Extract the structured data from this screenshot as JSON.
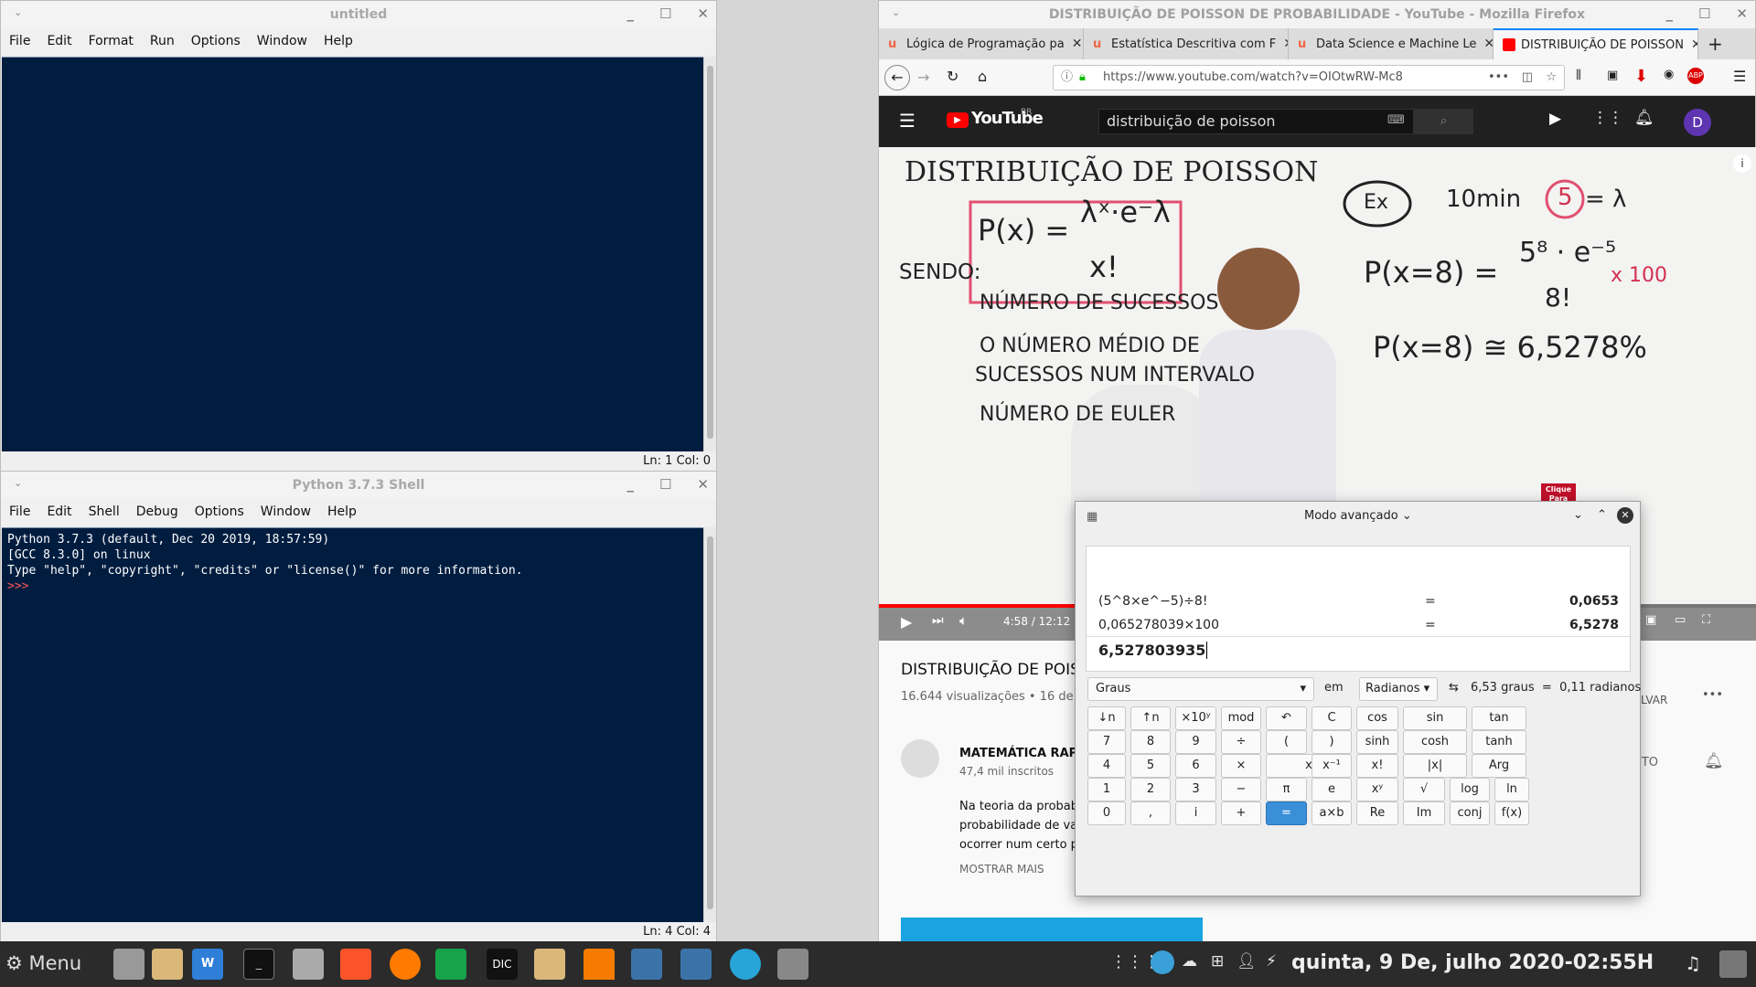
{
  "idle_editor": {
    "title": "untitled",
    "menu": [
      "File",
      "Edit",
      "Format",
      "Run",
      "Options",
      "Window",
      "Help"
    ],
    "status": "Ln: 1   Col: 0"
  },
  "idle_shell": {
    "title": "Python 3.7.3 Shell",
    "menu": [
      "File",
      "Edit",
      "Shell",
      "Debug",
      "Options",
      "Window",
      "Help"
    ],
    "lines": [
      "Python 3.7.3 (default, Dec 20 2019, 18:57:59)",
      "[GCC 8.3.0] on linux",
      "Type \"help\", \"copyright\", \"credits\" or \"license()\" for more information."
    ],
    "prompt": ">>>",
    "status": "Ln: 4   Col: 4"
  },
  "firefox": {
    "title": "DISTRIBUIÇÃO DE POISSON DE PROBABILIDADE - YouTube - Mozilla Firefox",
    "tabs": [
      {
        "label": "Lógica de Programação pa"
      },
      {
        "label": "Estatística Descritiva com F"
      },
      {
        "label": "Data Science e Machine Le"
      },
      {
        "label": "DISTRIBUIÇÃO DE POISSON"
      }
    ],
    "url": "https://www.youtube.com/watch?v=OIOtwRW-Mc8"
  },
  "youtube": {
    "logo": "YouTube",
    "region": "BR",
    "search": "distribuição de poisson",
    "avatar": "D",
    "video_time": "4:58 / 12:12",
    "video_title": "DISTRIBUIÇÃO DE POISS",
    "views": "16.644 visualizações • 16 de m",
    "channel": "MATEMÁTICA RAPID",
    "subs": "47,4 mil inscritos",
    "desc": [
      "Na teoria da probabi",
      "probabilidade de var",
      "ocorrer num certo pe"
    ],
    "more": "MOSTRAR MAIS",
    "save": "LVAR",
    "subscribe": "ITO",
    "badge": "Clique Para Assinar"
  },
  "whiteboard": {
    "heading": "DISTRIBUIÇÃO DE POISSON",
    "formula_num": "λˣ·e⁻λ",
    "formula_lhs": "P(x) =",
    "formula_den": "x!",
    "sendo": "SENDO:",
    "x_desc": "NÚMERO DE SUCESSOS",
    "lambda_desc1": "O NÚMERO MÉDIO DE",
    "lambda_desc2": "SUCESSOS NUM INTERVALO",
    "e_desc": "NÚMERO DE EULER",
    "ex": "Ex",
    "ex_line": "10min",
    "ex_val": "5",
    "ex_lam": "= λ",
    "calc_lhs": "P(x=8) =",
    "calc_num": "5⁸ · e⁻⁵",
    "calc_den": "8!",
    "calc_mult": "x 100",
    "result": "P(x=8) ≅ 6,5278%"
  },
  "calculator": {
    "mode": "Modo avançado",
    "history": [
      {
        "expr": "(5^8×e^−5)÷8!",
        "eq": "=",
        "val": "0,0653"
      },
      {
        "expr": "0,065278039×100",
        "eq": "=",
        "val": "6,5278"
      }
    ],
    "input": "6,527803935",
    "from_unit": "Graus",
    "in_label": "em",
    "to_unit": "Radianos",
    "conversion": "6,53 graus  =  0,11 radianos",
    "rows": [
      [
        "↓n",
        "↑n",
        "×10ʸ",
        "mod",
        "↶",
        "C",
        "cos",
        "sin",
        "tan"
      ],
      [
        "7",
        "8",
        "9",
        "÷",
        "(",
        ")",
        "sinh",
        "cosh",
        "tanh"
      ],
      [
        "4",
        "5",
        "6",
        "×",
        "x",
        "x⁻¹",
        "x!",
        "|x|",
        "Arg"
      ],
      [
        "1",
        "2",
        "3",
        "−",
        "π",
        "e",
        "xʸ",
        "√",
        "log",
        "ln"
      ],
      [
        "0",
        ",",
        "i",
        "+",
        "=",
        "a×b",
        "Re",
        "Im",
        "conj",
        "f(x)"
      ]
    ]
  },
  "taskbar": {
    "menu": "Menu",
    "clock": "quinta, 9 De, julho 2020-02:55H"
  }
}
